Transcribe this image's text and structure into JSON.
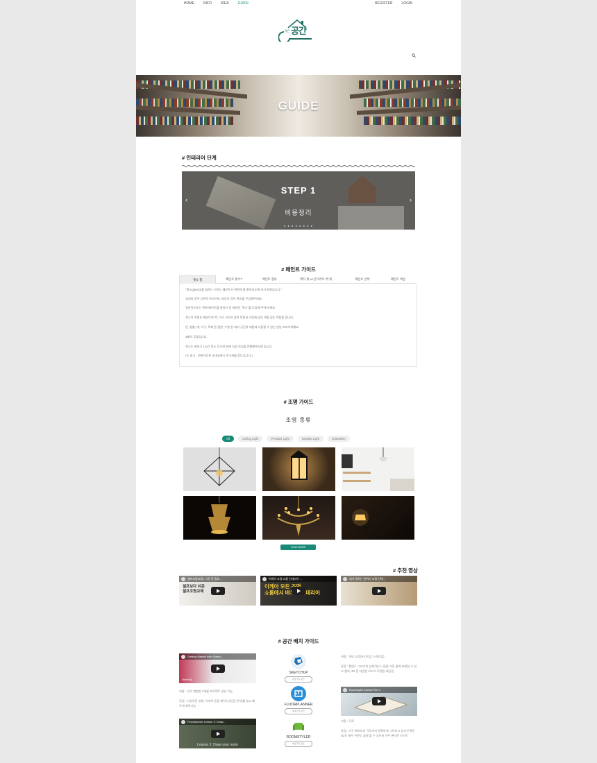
{
  "nav": {
    "left": [
      "HOME",
      "INFO",
      "IDEA",
      "GUIDE"
    ],
    "active": "GUIDE",
    "right": [
      "REGISTER",
      "LOGIN"
    ]
  },
  "logo": {
    "text": "공간",
    "small": "작은"
  },
  "icons": {
    "search": "search-icon",
    "prev": "chevron-left-icon",
    "next": "chevron-right-icon",
    "play": "play-icon"
  },
  "colors": {
    "accent": "#1a8a78",
    "page_bg": "#e9e9e9"
  },
  "hero": {
    "title": "GUIDE"
  },
  "interior": {
    "heading": "# 인테리어 단계",
    "slide": {
      "step": "STEP 1",
      "subtitle": "비용정리"
    },
    "prev": "‹",
    "next": "›",
    "dots": "● ● ● ● ● ● ● ●"
  },
  "paint": {
    "heading": "# 페인트 가이드",
    "tabs": [
      "젯소 칠",
      "페인트 횟수?",
      "페인트 종류",
      "벽지 위 vs 콘크리트 벽 위",
      "페인트 선택",
      "페인트 색상"
    ],
    "active_tab": 0,
    "body": [
      "\"젯소(gesso)를 칠하는 이유는 페인트가 벽면에 잘 흡착되도록 하기 위함입니다.\"",
      "실내의 경우 다목적 프라이머, 외부의 경우 젯소를 구입해주세요!",
      "일반적으로는 벽에 페인트를 칠하기 전 바탕면 \"젯소\"를 도장해 주어야 해요.",
      "젯소의 역할은 페인트와 벽, 가구 사이의 접착 역할과 기존에 있던 색을 덮는 역할을 합니다.",
      "문, 창틀, 벽, 가구, 목재 등 합판, 수용 등 여러 공간의 재질에 사용할 수 있는 만능 프라이머예요.",
      "3배의 무광입니다.",
      "젯소는 칠하고 1시간 정도 건조한 뒤에 다음 작업을 진행해주시면 됩니다.",
      "(※ 참고 : 보관기간은 실내보관시 약 6개월 정도입니다.)"
    ]
  },
  "lighting": {
    "heading": "# 조명 가이드",
    "subtitle": "조명 종류",
    "filters": [
      "All",
      "Ceiling Light",
      "Pendant Light",
      "Bracket Light",
      "chandelier"
    ],
    "active_filter": "All",
    "load_more": "LOAD MORE"
  },
  "videos": {
    "heading": "# 추천 영상",
    "items": [
      {
        "title": "셀프조명교체 | 시작 전 필요..."
      },
      {
        "title": "이케아 조명 쇼룸 인테리어 ..."
      },
      {
        "title": "내가 원하는 분위기 조명 선택..."
      }
    ],
    "thumb_texts": [
      "셀프보다 쉬운\n셀프조명교체",
      "이케아 모든 조명\n쇼룸에서 배우는 인테리어",
      ""
    ]
  },
  "layout_guide": {
    "heading": "# 공간 배치 가이드",
    "video_left_1": "Getting Started with Sketch...",
    "video_left_1_caption": "SketchUp",
    "left_price": "비용 : 무료 체험판 1개월 프로젝트 생성 가능",
    "left_desc": "장점 : 자유로운 방향, 이케아 등등 제작사 (한글 번역)를 쉽고 빠르게 제작가능",
    "video_left_2": "Floorplanner Lesson 2: Draw...",
    "video_left_2_caption": "Lesson 2: Draw your room",
    "tools": [
      {
        "name": "SKETCHUP",
        "button": "바로가기 링크"
      },
      {
        "name": "FLOORPLANNER",
        "button": "바로가기 링크"
      },
      {
        "name": "ROOMSTYLER",
        "button": "바로가기 링크"
      }
    ],
    "right_price": "비용 : 개인 무료(프리미엄 스케치업)",
    "right_desc": "장점 : 평면도 그리기와 입체적인 느낌을 가장 쉽게 표현할 수 있고 캡쳐, 3D 등 다양한 모드의 모델링 제공함",
    "video_right": "Roomstyler tutorial Part 1",
    "right2_price": "비용 : 무료",
    "right2_desc": "장점 : 가구 배치부터 각도까지 정확하게 그려보고 실시간 확인 · 3D로 매우 꾸준도 쉽게 볼 수 있어서 아주 편리한 사이트"
  }
}
